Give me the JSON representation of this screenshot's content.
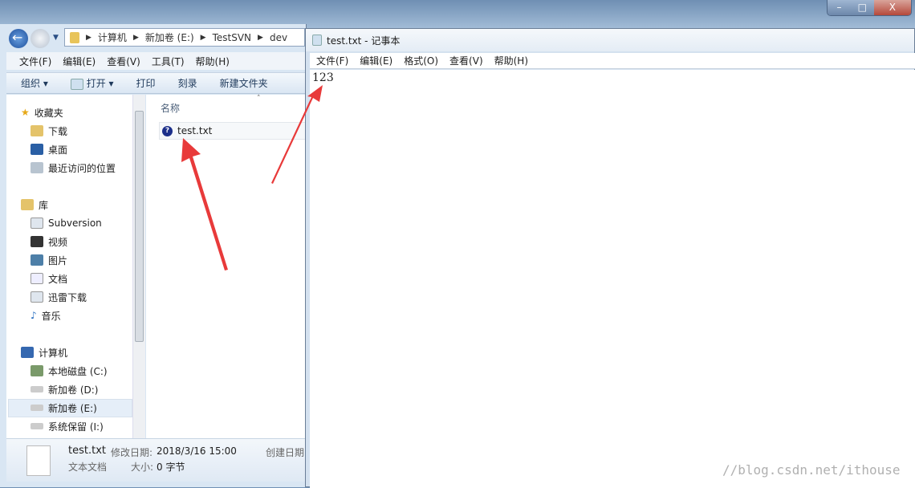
{
  "explorer": {
    "breadcrumb": [
      "计算机",
      "新加卷 (E:)",
      "TestSVN",
      "dev"
    ],
    "menu": [
      "文件(F)",
      "编辑(E)",
      "查看(V)",
      "工具(T)",
      "帮助(H)"
    ],
    "toolbar": {
      "organize": "组织",
      "open": "打开",
      "print": "打印",
      "burn": "刻录",
      "new_folder": "新建文件夹"
    },
    "nav": {
      "favorites": "收藏夹",
      "fav_items": [
        "下载",
        "桌面",
        "最近访问的位置"
      ],
      "libraries": "库",
      "lib_items": [
        "Subversion",
        "视频",
        "图片",
        "文档",
        "迅雷下载",
        "音乐"
      ],
      "computer": "计算机",
      "drives": [
        "本地磁盘 (C:)",
        "新加卷 (D:)",
        "新加卷 (E:)",
        "系统保留 (I:)"
      ]
    },
    "column_header": "名称",
    "files": [
      {
        "name": "test.txt",
        "icon": "svn-unversioned-question-icon"
      }
    ],
    "details": {
      "name": "test.txt",
      "type": "文本文档",
      "modified_label": "修改日期:",
      "modified": "2018/3/16 15:00",
      "size_label": "大小:",
      "size": "0 字节",
      "created_label": "创建日期"
    }
  },
  "notepad": {
    "title": "test.txt - 记事本",
    "menu": [
      "文件(F)",
      "编辑(E)",
      "格式(O)",
      "查看(V)",
      "帮助(H)"
    ],
    "content": "123"
  },
  "window_controls": [
    "minimize",
    "maximize",
    "close"
  ],
  "watermark": "//blog.csdn.net/ithouse",
  "colors": {
    "arrow": "#e83a3a",
    "selection": "#e5eef8"
  }
}
